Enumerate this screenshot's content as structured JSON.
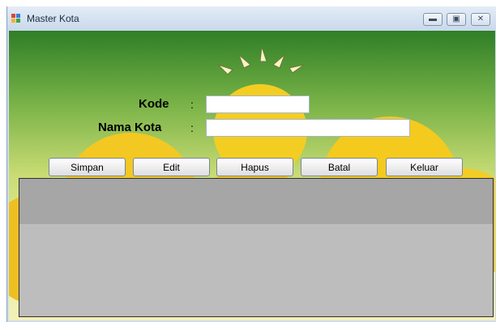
{
  "window": {
    "title": "Master Kota"
  },
  "form": {
    "kode_label": "Kode",
    "nama_kota_label": "Nama Kota",
    "colon": ":",
    "kode_value": "",
    "nama_kota_value": ""
  },
  "buttons": {
    "simpan": "Simpan",
    "edit": "Edit",
    "hapus": "Hapus",
    "batal": "Batal",
    "keluar": "Keluar"
  },
  "icons": [
    "app-icon",
    "minimize-icon",
    "maximize-icon",
    "close-icon"
  ],
  "colors": {
    "grid_background": "#bdbdbd",
    "grid_header": "#a6a6a6"
  }
}
